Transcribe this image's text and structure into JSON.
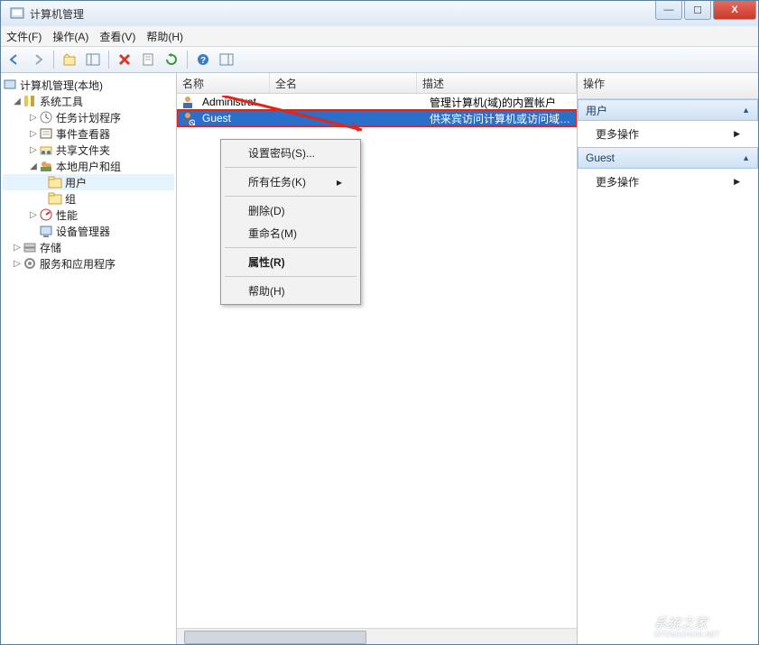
{
  "window": {
    "title": "计算机管理"
  },
  "menubar": {
    "file": "文件(F)",
    "action": "操作(A)",
    "view": "查看(V)",
    "help": "帮助(H)"
  },
  "tree": {
    "root": "计算机管理(本地)",
    "systools": "系统工具",
    "task": "任务计划程序",
    "event": "事件查看器",
    "shared": "共享文件夹",
    "localusers": "本地用户和组",
    "users": "用户",
    "groups": "组",
    "perf": "性能",
    "devmgr": "设备管理器",
    "storage": "存储",
    "services": "服务和应用程序"
  },
  "list": {
    "cols": {
      "name": "名称",
      "fullname": "全名",
      "desc": "描述"
    },
    "rows": [
      {
        "name": "Administrat...",
        "full": "",
        "desc": "管理计算机(域)的内置帐户"
      },
      {
        "name": "Guest",
        "full": "",
        "desc": "供来宾访问计算机或访问域的内..."
      }
    ]
  },
  "ctx": {
    "setpwd": "设置密码(S)...",
    "alltasks": "所有任务(K)",
    "delete": "删除(D)",
    "rename": "重命名(M)",
    "props": "属性(R)",
    "help": "帮助(H)"
  },
  "right": {
    "title": "操作",
    "sect1": "用户",
    "more1": "更多操作",
    "sect2": "Guest",
    "more2": "更多操作"
  },
  "glyph": {
    "tri_r": "▶",
    "tri_d": "▸",
    "chev": "▲",
    "chevr": "▶",
    "min": "—",
    "max": "☐",
    "close": "X"
  }
}
